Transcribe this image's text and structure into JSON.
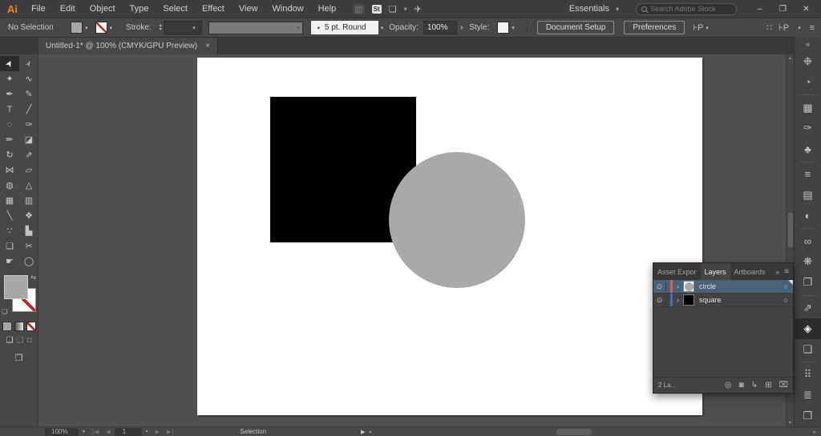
{
  "colors": {
    "fill_gray": "#a7a7a7",
    "square_black": "#000000",
    "circle_gray": "#a9a9a9",
    "layer_circle_bar": "#d95b52",
    "layer_square_bar": "#4d68cf"
  },
  "glyphs": {
    "chevron_down": "▾",
    "chevron_up": "▴",
    "disclosure": "›",
    "eye": "⊙",
    "target": "○",
    "double_chevron_left": "«",
    "double_chevron_right": "»",
    "menu": "≡",
    "bullet": "•",
    "swap": "⇆",
    "mini_default": "❏",
    "opacity_arrow": "›",
    "scroll_up": "▴",
    "scroll_down": "▾",
    "scroll_left": "◂",
    "scroll_right": "▸",
    "nav_first": "|◀",
    "nav_prev": "◀",
    "nav_next": "▶",
    "nav_last": "▶|",
    "expand": "▶",
    "grid_dots": "∷",
    "snap_pixel": "⊦P"
  },
  "menubar": {
    "logo": "Ai",
    "items": [
      "File",
      "Edit",
      "Object",
      "Type",
      "Select",
      "Effect",
      "View",
      "Window",
      "Help"
    ],
    "icons": [
      {
        "name": "gpu-performance-icon",
        "glyph": "▥",
        "cls": "dim"
      },
      {
        "name": "adobe-stock-icon",
        "glyph": "St",
        "cls": "stock"
      },
      {
        "name": "arrange-documents-icon",
        "glyph": "❏"
      },
      {
        "name": "arrange-documents-chevron-icon",
        "glyph": "▾",
        "cls": "small"
      },
      {
        "name": "share-icon",
        "glyph": "✈"
      }
    ],
    "workspace_label": "Essentials",
    "search_placeholder": "Search Adobe Stock",
    "window_controls": [
      {
        "name": "minimize-button",
        "glyph": "–"
      },
      {
        "name": "restore-button",
        "glyph": "❐"
      },
      {
        "name": "close-button",
        "glyph": "✕"
      }
    ]
  },
  "controlbar": {
    "selection_label": "No Selection",
    "stroke_label": "Stroke:",
    "brush_value": "5 pt. Round",
    "opacity_label": "Opacity:",
    "opacity_value": "100%",
    "style_label": "Style:",
    "document_setup_label": "Document Setup",
    "preferences_label": "Preferences"
  },
  "tabbar": {
    "title": "Untitled-1* @ 100% (CMYK/GPU Preview)",
    "close": "×"
  },
  "toolbar": {
    "tools": [
      {
        "name": "selection-tool",
        "glyph": "➤",
        "cls": "rot60",
        "active": true
      },
      {
        "name": "direct-selection-tool",
        "glyph": "➢",
        "cls": "rot60"
      },
      {
        "name": "magic-wand-tool",
        "glyph": "✦"
      },
      {
        "name": "lasso-tool",
        "glyph": "∿"
      },
      {
        "name": "pen-tool",
        "glyph": "✒"
      },
      {
        "name": "curvature-tool",
        "glyph": "✎"
      },
      {
        "name": "type-tool",
        "glyph": "T"
      },
      {
        "name": "line-segment-tool",
        "glyph": "╱"
      },
      {
        "name": "ellipse-tool",
        "glyph": "◌"
      },
      {
        "name": "paintbrush-tool",
        "glyph": "✑"
      },
      {
        "name": "shaper-tool",
        "glyph": "✏"
      },
      {
        "name": "eraser-tool",
        "glyph": "◪"
      },
      {
        "name": "rotate-tool",
        "glyph": "↻"
      },
      {
        "name": "scale-tool",
        "glyph": "⇗"
      },
      {
        "name": "width-tool",
        "glyph": "⋈"
      },
      {
        "name": "free-transform-tool",
        "glyph": "▱"
      },
      {
        "name": "shape-builder-tool",
        "glyph": "◍"
      },
      {
        "name": "perspective-grid-tool",
        "glyph": "△"
      },
      {
        "name": "mesh-tool",
        "glyph": "▦"
      },
      {
        "name": "gradient-tool",
        "glyph": "▥"
      },
      {
        "name": "eyedropper-tool",
        "glyph": "╲"
      },
      {
        "name": "blend-tool",
        "glyph": "❖"
      },
      {
        "name": "symbol-sprayer-tool",
        "glyph": "∵"
      },
      {
        "name": "column-graph-tool",
        "glyph": "▙"
      },
      {
        "name": "artboard-tool",
        "glyph": "❏"
      },
      {
        "name": "slice-tool",
        "glyph": "✂"
      },
      {
        "name": "hand-tool",
        "glyph": "☛"
      },
      {
        "name": "zoom-tool",
        "glyph": "◯"
      }
    ]
  },
  "rightstrip": {
    "collapse": "«",
    "icons": [
      {
        "name": "color-panel-icon",
        "glyph": "❉"
      },
      {
        "name": "color-guide-panel-icon",
        "glyph": "◔"
      },
      {
        "name": "separator",
        "sep": true
      },
      {
        "name": "swatches-panel-icon",
        "glyph": "▦"
      },
      {
        "name": "brushes-panel-icon",
        "glyph": "✑"
      },
      {
        "name": "symbols-panel-icon",
        "glyph": "♣"
      },
      {
        "name": "separator",
        "sep": true
      },
      {
        "name": "stroke-panel-icon",
        "glyph": "≡"
      },
      {
        "name": "gradient-panel-icon",
        "glyph": "▤"
      },
      {
        "name": "transparency-panel-icon",
        "glyph": "◐"
      },
      {
        "name": "separator",
        "sep": true
      },
      {
        "name": "libraries-panel-icon",
        "glyph": "∞"
      },
      {
        "name": "appearance-panel-icon",
        "glyph": "❋"
      },
      {
        "name": "graphic-styles-panel-icon",
        "glyph": "❐"
      },
      {
        "name": "separator",
        "sep": true
      },
      {
        "name": "asset-export-panel-icon",
        "glyph": "⇗"
      },
      {
        "name": "layers-panel-icon",
        "glyph": "◈",
        "active": true
      },
      {
        "name": "artboards-panel-icon",
        "glyph": "❏"
      },
      {
        "name": "separator",
        "sep": true
      },
      {
        "name": "transform-panel-icon",
        "glyph": "⠿"
      },
      {
        "name": "align-panel-icon",
        "glyph": "≣"
      },
      {
        "name": "pathfinder-panel-icon",
        "glyph": "❒"
      }
    ]
  },
  "layers_panel": {
    "tabs": [
      {
        "label": "Asset Expor"
      },
      {
        "label": "Layers",
        "active": true
      },
      {
        "label": "Artboards"
      }
    ],
    "rows": [
      {
        "label": "circle",
        "color": "#d95b52",
        "thumb_shape": "circle",
        "thumb_color": "#a9a9a9",
        "selected": true
      },
      {
        "label": "square",
        "color": "#4d68cf",
        "thumb_shape": "square",
        "thumb_color": "#000000"
      }
    ],
    "footer": {
      "count": "2 La...",
      "icons": [
        {
          "name": "locate-object-icon",
          "glyph": "◎"
        },
        {
          "name": "make-clip-mask-icon",
          "glyph": "◙"
        },
        {
          "name": "new-sublayer-icon",
          "glyph": "↳"
        },
        {
          "name": "new-layer-icon",
          "glyph": "⊞"
        },
        {
          "name": "delete-layer-icon",
          "glyph": "⌧"
        }
      ]
    }
  },
  "statusbar": {
    "zoom_value": "100%",
    "artboard_value": "1",
    "tool_label": "Selection"
  }
}
